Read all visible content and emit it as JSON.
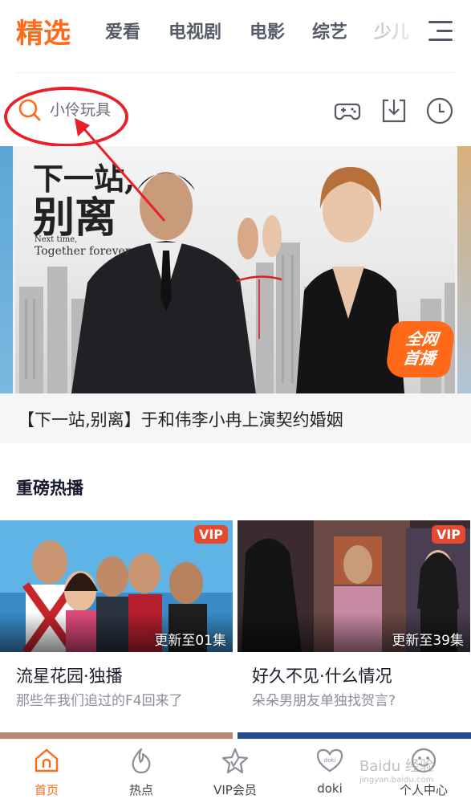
{
  "top_tabs": [
    "精选",
    "爱看",
    "电视剧",
    "电影",
    "综艺",
    "少儿"
  ],
  "search": {
    "placeholder_text": "小伶玩具"
  },
  "banner": {
    "poster_title_line1": "下一站,",
    "poster_title_line2": "别离",
    "poster_sub_line1": "Next time,",
    "poster_sub_line2": "Together forever",
    "badge_line1": "全网",
    "badge_line2": "首播",
    "caption": "【下一站,别离】于和伟李小冉上演契约婚姻"
  },
  "section": {
    "title": "重磅热播",
    "cards": [
      {
        "badge": "VIP",
        "update": "更新至01集",
        "title": "流星花园·独播",
        "subtitle": "那些年我们追过的F4回来了"
      },
      {
        "badge": "VIP",
        "update": "更新至39集",
        "title": "好久不见·什么情况",
        "subtitle": "朵朵男朋友单独找贺言?"
      }
    ]
  },
  "bottom_nav": [
    {
      "label": "首页",
      "icon": "home-icon",
      "active": true
    },
    {
      "label": "热点",
      "icon": "flame-icon",
      "active": false
    },
    {
      "label": "VIP会员",
      "icon": "vip-star-icon",
      "active": false
    },
    {
      "label": "doki",
      "icon": "doki-heart-icon",
      "active": false
    },
    {
      "label": "个人中心",
      "icon": "smiley-icon",
      "active": false
    }
  ],
  "watermark": {
    "line1": "Baidu 经验",
    "line2": "jingyan.baidu.com"
  },
  "colors": {
    "accent": "#ff6a1a",
    "annotation_red": "#e8202a",
    "vip_badge": "#e64a2e"
  }
}
